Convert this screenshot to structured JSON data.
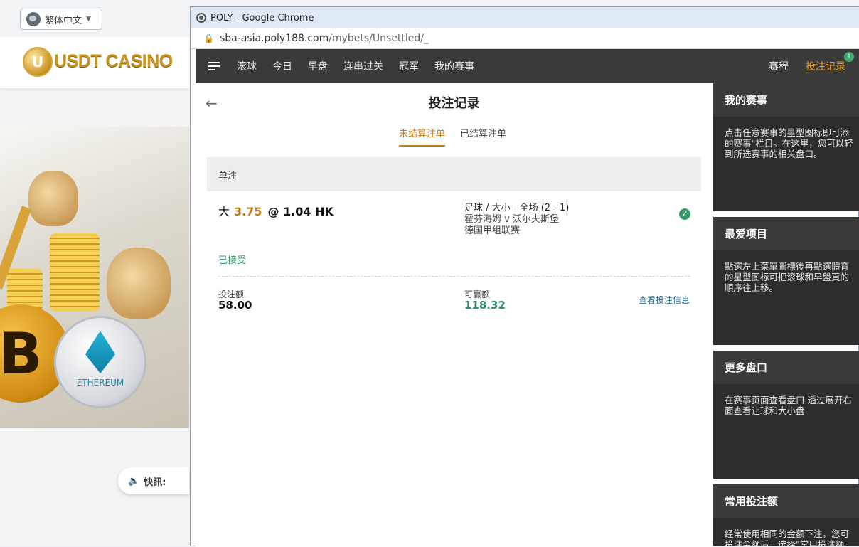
{
  "background": {
    "language": "繁体中文",
    "logo_letter": "U",
    "logo_text": "USDT CASINO",
    "eth_coin_label": "ETHEREUM",
    "btc_symbol": "B",
    "news_label": "快訊:"
  },
  "window": {
    "title": "POLY - Google Chrome",
    "url_domain": "sba-asia.poly188.com",
    "url_path": "/mybets/Unsettled/_"
  },
  "nav": {
    "items": [
      "滚球",
      "今日",
      "早盘",
      "连串过关",
      "冠军",
      "我的赛事"
    ],
    "schedule": "赛程",
    "bet_record": "投注记录",
    "badge": "1"
  },
  "page": {
    "title": "投注记录",
    "tabs": [
      "未结算注单",
      "已结算注单"
    ],
    "section": "单注"
  },
  "bet": {
    "selection": "大",
    "line": "3.75",
    "odds": "@ 1.04 HK",
    "market": "足球 / 大小 - 全场 (2 - 1)",
    "teams": "霍芬海姆 v 沃尔夫斯堡",
    "league": "德国甲组联赛",
    "status": "已接受",
    "stake_label": "投注额",
    "stake": "58.00",
    "win_label": "可赢额",
    "win": "118.32",
    "view_info": "查看投注信息"
  },
  "panels": [
    {
      "title": "我的赛事",
      "lines": [
        "点击任意赛事的星型图标即可添",
        "的赛事\"栏目。在这里，您可以轻",
        "到所选赛事的相关盘口。"
      ]
    },
    {
      "title": "最爱项目",
      "lines": [
        "點選左上菜單圖標後再點選體育",
        "的星型图标可把滚球和早盤頁的",
        "順序往上移。"
      ]
    },
    {
      "title": "更多盘口",
      "lines": [
        "在赛事页面查看盘口 透过展开右",
        "面查看让球和大小盘"
      ]
    },
    {
      "title": "常用投注额",
      "lines": [
        "经常使用相同的金额下注，您可",
        "投注金额后，选择\"常用投注额"
      ]
    }
  ]
}
